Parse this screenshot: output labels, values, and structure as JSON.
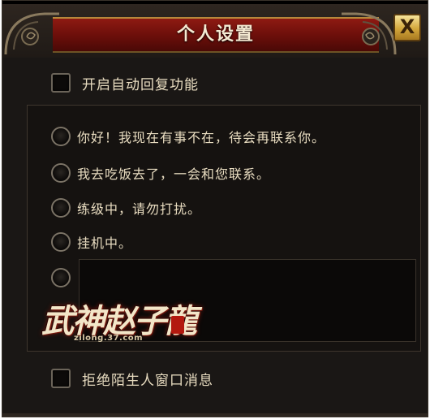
{
  "window": {
    "title": "个人设置",
    "close_label": "X"
  },
  "auto_reply": {
    "label": "开启自动回复功能",
    "checked": false
  },
  "reply_options": [
    {
      "label": "你好！我现在有事不在，待会再联系你。",
      "selected": false
    },
    {
      "label": "我去吃饭去了，一会和您联系。",
      "selected": false
    },
    {
      "label": "练级中，请勿打扰。",
      "selected": false
    },
    {
      "label": "挂机中。",
      "selected": false
    },
    {
      "label": "",
      "selected": false
    }
  ],
  "custom_reply": {
    "value": ""
  },
  "watermark": {
    "logo_text": "武神赵子龍",
    "url": "zilong.37.com"
  },
  "reject_strangers": {
    "label": "拒绝陌生人窗口消息",
    "checked": false
  },
  "colors": {
    "title_bar": "#6a0e0a",
    "gold_trim": "#b8883b",
    "text": "#e8dcc0",
    "background": "#1a1715"
  }
}
